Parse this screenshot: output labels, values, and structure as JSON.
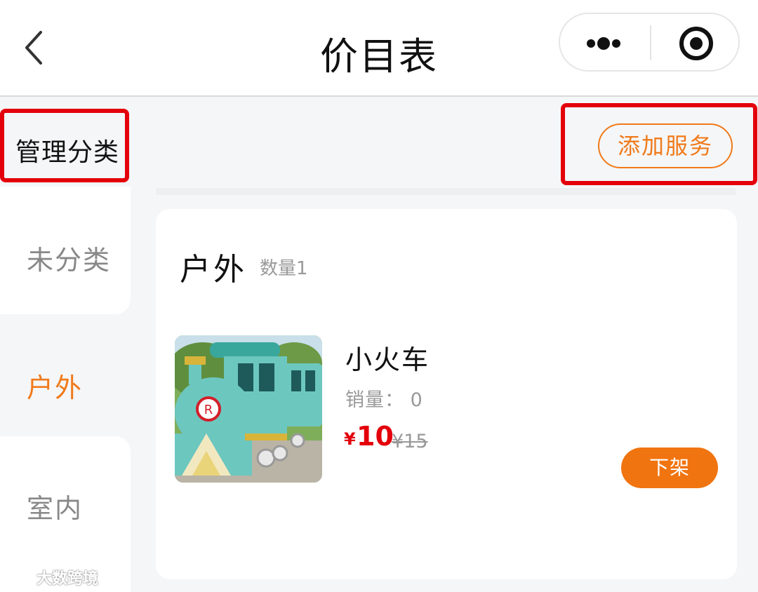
{
  "header": {
    "title": "价目表",
    "back_icon": "chevron-left-icon",
    "more_icon": "more-dots-icon",
    "close_icon": "target-circle-icon"
  },
  "sidebar": {
    "manage_label": "管理分类",
    "categories": [
      {
        "label": "未分类",
        "selected": false
      },
      {
        "label": "户外",
        "selected": true
      },
      {
        "label": "室内",
        "selected": false
      }
    ]
  },
  "toolbar": {
    "add_service_label": "添加服务"
  },
  "section": {
    "title": "户外",
    "count_label": "数量1"
  },
  "items": [
    {
      "name": "小火车",
      "sales_label": "销量：",
      "sales_value": "0",
      "price_symbol": "¥",
      "price": "10",
      "original_price": "¥15",
      "action_label": "下架"
    }
  ],
  "watermark": "大数跨境",
  "colors": {
    "accent": "#f07a1a",
    "price": "#e3000b",
    "annotation": "#e3000b"
  }
}
